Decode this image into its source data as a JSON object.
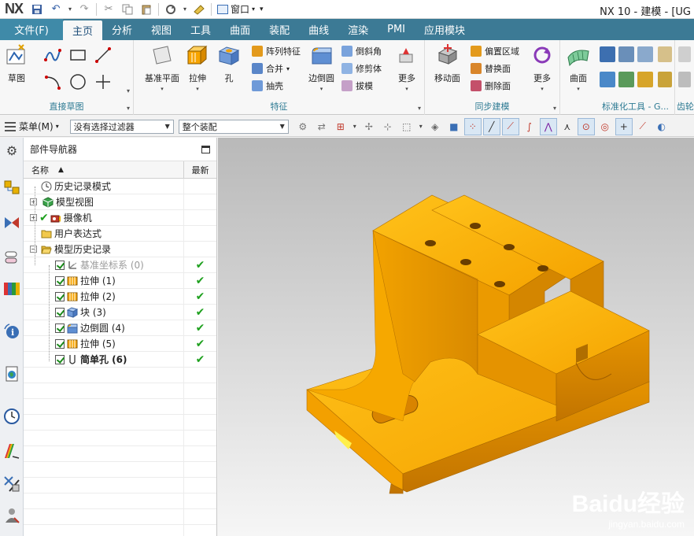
{
  "titlebar": {
    "logo": "NX",
    "window_menu": "窗口",
    "title": "NX 10 - 建模 - [UG"
  },
  "tabs": {
    "file": "文件(F)",
    "items": [
      "主页",
      "分析",
      "视图",
      "工具",
      "曲面",
      "装配",
      "曲线",
      "渲染",
      "PMI",
      "应用模块"
    ]
  },
  "ribbon": {
    "sketch": {
      "label": "草图",
      "group_label": "直接草图"
    },
    "feature": {
      "group_label": "特征",
      "datum_plane": "基准平面",
      "extrude": "拉伸",
      "hole": "孔",
      "pattern": "阵列特征",
      "unite": "合并",
      "shell": "抽壳",
      "edge_blend": "边倒圆",
      "chamfer": "倒斜角",
      "trim_body": "修剪体",
      "draft": "拔模",
      "more": "更多"
    },
    "sync": {
      "group_label": "同步建模",
      "move_face": "移动面",
      "offset_region": "偏置区域",
      "replace_face": "替换面",
      "delete_face": "删除面",
      "more": "更多"
    },
    "surface": {
      "label": "曲面"
    },
    "std_tools": {
      "group_label": "标准化工具 - G..."
    },
    "gear": {
      "group_label": "齿轮"
    }
  },
  "toolbar": {
    "menu": "菜单(M)",
    "filter": "没有选择过滤器",
    "scope": "整个装配"
  },
  "navigator": {
    "title": "部件导航器",
    "col_name": "名称",
    "col_latest": "最新",
    "rows": [
      {
        "label": "历史记录模式"
      },
      {
        "label": "模型视图"
      },
      {
        "label": "摄像机"
      },
      {
        "label": "用户表达式"
      },
      {
        "label": "模型历史记录"
      },
      {
        "label": "基准坐标系 (0)"
      },
      {
        "label": "拉伸 (1)"
      },
      {
        "label": "拉伸 (2)"
      },
      {
        "label": "块 (3)"
      },
      {
        "label": "边倒圆 (4)"
      },
      {
        "label": "拉伸 (5)"
      },
      {
        "label": "简单孔 (6)"
      }
    ]
  },
  "watermark": {
    "main": "Baidu经验",
    "sub": "jingyan.baidu.com"
  },
  "colors": {
    "tabbar": "#3c7a95",
    "model_top": "#ffb400",
    "model_side": "#e38e00",
    "model_front": "#c87800",
    "check_green": "#1ea01e"
  }
}
